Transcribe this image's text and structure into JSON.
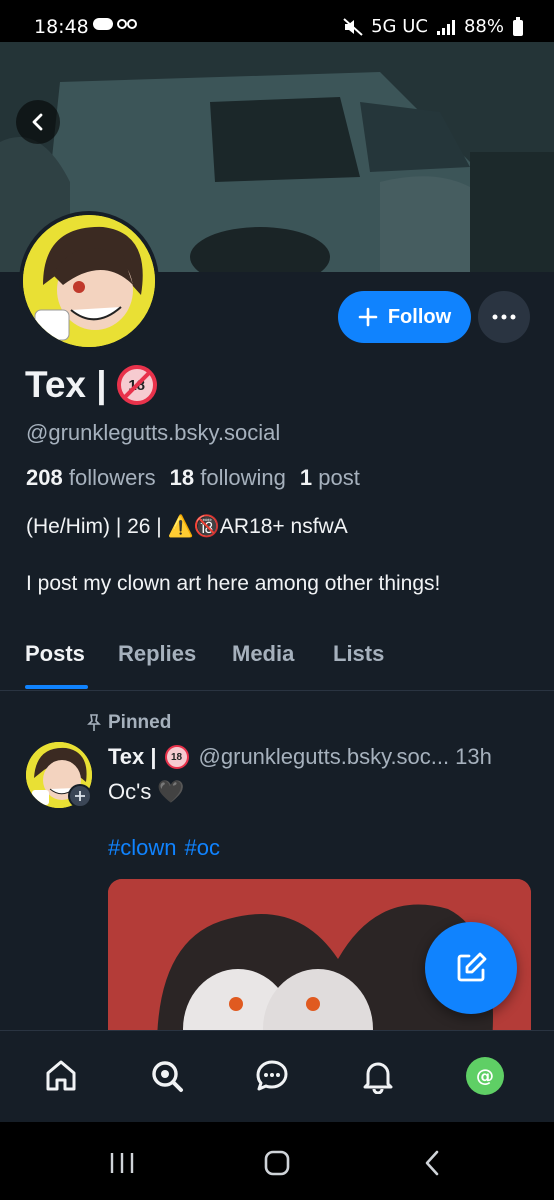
{
  "status_bar": {
    "time": "18:48",
    "left_icons": "⌂ ∞",
    "network": "5G UC",
    "signal": "▐",
    "battery": "88%"
  },
  "profile": {
    "display_name": "Tex |",
    "age_badge": "18",
    "handle": "@grunklegutts.bsky.social",
    "followers_count": "208",
    "followers_label": "followers",
    "following_count": "18",
    "following_label": "following",
    "posts_count": "1",
    "posts_label": "post",
    "bio_line1": "(He/Him) | 26 |  ⚠️🔞AR18+ nsfwA",
    "bio_line2": "I post my clown art here among other things!"
  },
  "actions": {
    "follow_label": "Follow",
    "follow_icon": "plus-icon",
    "more_icon": "ellipsis-icon"
  },
  "tabs": [
    {
      "label": "Posts"
    },
    {
      "label": "Replies"
    },
    {
      "label": "Media"
    },
    {
      "label": "Lists"
    }
  ],
  "post": {
    "pinned_label": "Pinned",
    "author": "Tex |",
    "badge": "18",
    "handle": "@grunklegutts.bsky.soc...",
    "time": "13h",
    "text": "Oc's 🖤",
    "hashtags": [
      "#clown",
      "#oc"
    ]
  },
  "bottom_nav": [
    "home-icon",
    "search-icon",
    "chat-icon",
    "bell-icon",
    "profile-avatar"
  ],
  "colors": {
    "background": "#161e27",
    "accent": "#1083fe",
    "muted": "#a6b1bd"
  }
}
